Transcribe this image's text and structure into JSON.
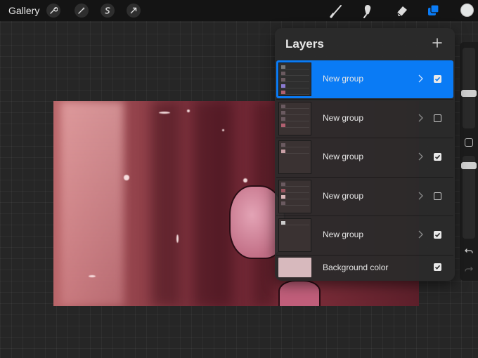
{
  "topbar": {
    "gallery_label": "Gallery",
    "tools_left": [
      "wrench-icon",
      "magic-wand-icon",
      "selection-s-icon",
      "transform-arrow-icon"
    ],
    "tools_right": [
      "brush-icon",
      "smudge-icon",
      "eraser-icon",
      "layers-icon"
    ],
    "current_color": "#e3e6e6"
  },
  "layers_panel": {
    "title": "Layers",
    "rows": [
      {
        "name": "New group",
        "visible": true,
        "selected": true
      },
      {
        "name": "New group",
        "visible": false,
        "selected": false
      },
      {
        "name": "New group",
        "visible": true,
        "selected": false
      },
      {
        "name": "New group",
        "visible": false,
        "selected": false
      },
      {
        "name": "New group",
        "visible": true,
        "selected": false
      }
    ],
    "background": {
      "name": "Background color",
      "visible": true,
      "color": "#d7b9bd"
    }
  },
  "colors": {
    "accent": "#0a7bf5",
    "panel": "#2a2a2a",
    "topbar": "#141414"
  }
}
